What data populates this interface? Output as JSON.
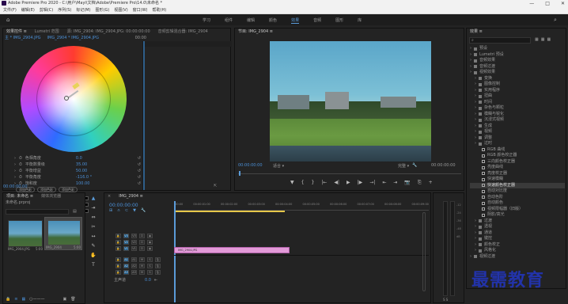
{
  "window": {
    "title": "Adobe Premiere Pro 2020 - C:\\用户\\Mayi\\文档\\Adobe\\Premiere Pro\\14.0\\未命名 *",
    "min": "—",
    "max": "□",
    "close": "✕"
  },
  "menu": [
    "文件(F)",
    "编辑(E)",
    "剪辑(C)",
    "序列(S)",
    "标记(M)",
    "图形(G)",
    "视图(V)",
    "窗口(W)",
    "帮助(H)"
  ],
  "workspaces": [
    "学习",
    "组件",
    "编辑",
    "颜色",
    "效果",
    "音频",
    "图形",
    "库"
  ],
  "active_workspace": "效果",
  "left_panel": {
    "tabs": [
      "效果控件 ≡",
      "Lumetri 范围",
      "源: IMG_2904: IMG_2904.JPG: 00:00:00:00",
      "音频剪辑混合器: IMG_2904"
    ],
    "subtabs": [
      "主 * IMG_2904.JPG",
      "IMG_2904 * IMG_2904.JPG"
    ],
    "timecode_top": "00:00",
    "rows": [
      {
        "label": "色相角度",
        "value": "0.0"
      },
      {
        "label": "平衡数量级",
        "value": "35.00"
      },
      {
        "label": "平衡增益",
        "value": "50.00"
      },
      {
        "label": "平衡角度",
        "value": "-116.0 °"
      },
      {
        "label": "饱和度",
        "value": "100.00"
      }
    ],
    "buttons": [
      "添加色彩",
      "添加色彩",
      "添加色彩"
    ],
    "color_rows": [
      "高光色",
      "中间色",
      "阴影色"
    ],
    "bottom_timecode": "00:00:00:00"
  },
  "program": {
    "title": "节目: IMG_2904 ≡",
    "timecode": "00:00:00:00",
    "fit": "适合",
    "quality": "完整",
    "end_timecode": "00:00:00:00",
    "controls": [
      "▼",
      "{",
      "}",
      "|←",
      "◀|",
      "▶",
      "|▶",
      "→|",
      "⇤",
      "⇥",
      "📷",
      "⎘",
      "+"
    ]
  },
  "effects_panel": {
    "title": "效果 ≡",
    "search_placeholder": "",
    "tree": [
      {
        "label": "预设",
        "indent": 0
      },
      {
        "label": "Lumetri 预设",
        "indent": 0
      },
      {
        "label": "音频效果",
        "indent": 0
      },
      {
        "label": "音频过渡",
        "indent": 0
      },
      {
        "label": "视频效果",
        "indent": 0
      },
      {
        "label": "变换",
        "indent": 1
      },
      {
        "label": "图像控制",
        "indent": 1
      },
      {
        "label": "实用程序",
        "indent": 1
      },
      {
        "label": "扭曲",
        "indent": 1
      },
      {
        "label": "时间",
        "indent": 1
      },
      {
        "label": "杂色与颗粒",
        "indent": 1
      },
      {
        "label": "模糊与锐化",
        "indent": 1
      },
      {
        "label": "沉浸式视频",
        "indent": 1
      },
      {
        "label": "生成",
        "indent": 1
      },
      {
        "label": "视频",
        "indent": 1
      },
      {
        "label": "调整",
        "indent": 1
      },
      {
        "label": "过时",
        "indent": 1
      },
      {
        "label": "RGB 曲线",
        "indent": 2
      },
      {
        "label": "RGB 颜色校正器",
        "indent": 2
      },
      {
        "label": "三向颜色校正器",
        "indent": 2
      },
      {
        "label": "亮度曲线",
        "indent": 2
      },
      {
        "label": "亮度校正器",
        "indent": 2
      },
      {
        "label": "快速模糊",
        "indent": 2
      },
      {
        "label": "快速颜色校正器",
        "indent": 2,
        "selected": true
      },
      {
        "label": "自动对比度",
        "indent": 2
      },
      {
        "label": "自动色阶",
        "indent": 2
      },
      {
        "label": "自动颜色",
        "indent": 2
      },
      {
        "label": "视频限幅器（旧版）",
        "indent": 2
      },
      {
        "label": "阴影/高光",
        "indent": 2
      },
      {
        "label": "过渡",
        "indent": 1
      },
      {
        "label": "透视",
        "indent": 1
      },
      {
        "label": "通道",
        "indent": 1
      },
      {
        "label": "键控",
        "indent": 1
      },
      {
        "label": "颜色校正",
        "indent": 1
      },
      {
        "label": "风格化",
        "indent": 1
      },
      {
        "label": "视频过渡",
        "indent": 0
      }
    ]
  },
  "project_panel": {
    "tabs": [
      "项目: 未命名 ≡",
      "媒体浏览器"
    ],
    "path": "未命名.prproj",
    "items": [
      {
        "name": "IMG_2904.JPG",
        "duration": "5:00"
      },
      {
        "name": "IMG_2904",
        "duration": "5:00"
      }
    ]
  },
  "timeline": {
    "tab": "IMG_2904 ≡",
    "timecode": "00:00:00:00",
    "ruler": [
      ":00:00",
      "00:00:01:00",
      "00:00:02:00",
      "00:00:03:00",
      "00:00:04:00",
      "00:00:05:00",
      "00:00:06:00",
      "00:00:07:00",
      "00:00:08:00",
      "00:00:09:00"
    ],
    "video_tracks": [
      "V3",
      "V2",
      "V1"
    ],
    "audio_tracks": [
      "A1",
      "A2",
      "A3"
    ],
    "master": "主声道",
    "master_value": "0.0",
    "clip": "IMG_2904.JPG"
  },
  "watermark": "最需教育",
  "colors": {
    "accent": "#5a9bd8",
    "clip": "#e29ad8",
    "selection": "#3a3a3a"
  }
}
